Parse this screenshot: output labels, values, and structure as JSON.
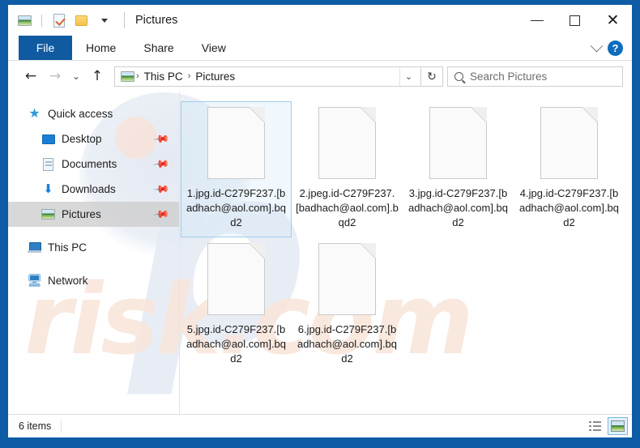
{
  "window": {
    "title": "Pictures",
    "quick_access_toolbar": [
      {
        "name": "pictures-icon",
        "label": "Pictures"
      },
      {
        "name": "properties-icon",
        "label": "Properties"
      },
      {
        "name": "new-folder-icon",
        "label": "New folder"
      },
      {
        "name": "customize-dropdown-icon",
        "label": "Customize Quick Access Toolbar"
      }
    ],
    "caption_buttons": {
      "minimize": "–",
      "maximize": "□",
      "close": "✕"
    }
  },
  "ribbon": {
    "tabs": [
      {
        "label": "File",
        "active": true
      },
      {
        "label": "Home",
        "active": false
      },
      {
        "label": "Share",
        "active": false
      },
      {
        "label": "View",
        "active": false
      }
    ],
    "collapse_icon": "chevron-down-icon",
    "help_label": "?"
  },
  "address_bar": {
    "back_icon": "←",
    "forward_icon": "→",
    "recent_icon": "⌄",
    "up_icon": "↑",
    "breadcrumb": [
      "This PC",
      "Pictures"
    ],
    "breadcrumb_separator": "›",
    "breadcrumb_dropdown_icon": "⌄",
    "refresh_icon": "↻"
  },
  "search": {
    "placeholder": "Search Pictures",
    "icon": "search-icon"
  },
  "sidebar": {
    "items": [
      {
        "label": "Quick access",
        "icon": "star-icon",
        "level": 0,
        "selected": false,
        "pinned": false
      },
      {
        "label": "Desktop",
        "icon": "desktop-icon",
        "level": 1,
        "selected": false,
        "pinned": true
      },
      {
        "label": "Documents",
        "icon": "documents-icon",
        "level": 1,
        "selected": false,
        "pinned": true
      },
      {
        "label": "Downloads",
        "icon": "downloads-icon",
        "level": 1,
        "selected": false,
        "pinned": true
      },
      {
        "label": "Pictures",
        "icon": "pictures-icon",
        "level": 1,
        "selected": true,
        "pinned": true
      },
      {
        "label": "This PC",
        "icon": "this-pc-icon",
        "level": 0,
        "selected": false,
        "pinned": false
      },
      {
        "label": "Network",
        "icon": "network-icon",
        "level": 0,
        "selected": false,
        "pinned": false
      }
    ],
    "pin_glyph": "📌"
  },
  "files": [
    {
      "name": "1.jpg.id-C279F237.[badhach@aol.com].bqd2",
      "selected": true
    },
    {
      "name": "2.jpeg.id-C279F237.[badhach@aol.com].bqd2",
      "selected": false
    },
    {
      "name": "3.jpg.id-C279F237.[badhach@aol.com].bqd2",
      "selected": false
    },
    {
      "name": "4.jpg.id-C279F237.[badhach@aol.com].bqd2",
      "selected": false
    },
    {
      "name": "5.jpg.id-C279F237.[badhach@aol.com].bqd2",
      "selected": false
    },
    {
      "name": "6.jpg.id-C279F237.[badhach@aol.com].bqd2",
      "selected": false
    }
  ],
  "status_bar": {
    "item_count": "6 items",
    "views": [
      {
        "name": "details-view-button",
        "active": false
      },
      {
        "name": "large-icons-view-button",
        "active": true
      }
    ]
  },
  "watermark": {
    "text": "risk.com",
    "letter": "p"
  },
  "colors": {
    "accent": "#0e5ba6",
    "file_tab": "#0f5aa0",
    "selection_border": "#9fcdeb",
    "sidebar_selection": "#cdcdcd",
    "help_blue": "#0f6cbd"
  }
}
